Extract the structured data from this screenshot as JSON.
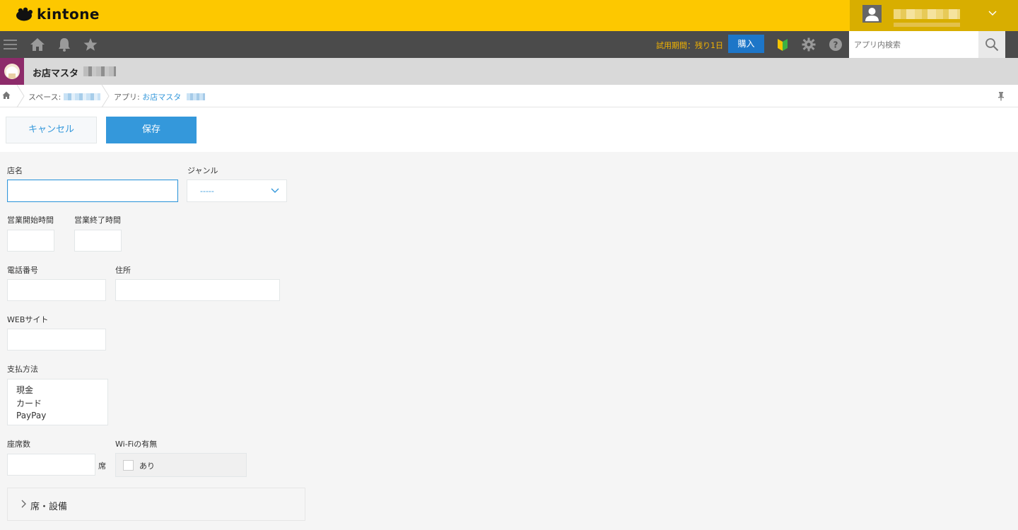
{
  "header": {
    "logo_text": "kintone",
    "user_menu_icon": "chevron-down-icon"
  },
  "nav": {
    "icons": [
      "menu-icon",
      "home-icon",
      "bell-icon",
      "star-icon"
    ],
    "trial_text": "試用期間：残り1日",
    "buy_label": "購入",
    "search_placeholder": "アプリ内検索"
  },
  "app": {
    "title": "お店マスタ"
  },
  "breadcrumb": {
    "space_prefix": "スペース: ",
    "app_prefix": "アプリ: ",
    "app_name": "お店マスタ"
  },
  "toolbar": {
    "cancel_label": "キャンセル",
    "save_label": "保存"
  },
  "form": {
    "shop_name_label": "店名",
    "genre_label": "ジャンル",
    "genre_value": "-----",
    "open_time_label": "営業開始時間",
    "close_time_label": "営業終了時間",
    "phone_label": "電話番号",
    "address_label": "住所",
    "website_label": "WEBサイト",
    "payment_label": "支払方法",
    "payment_options": [
      "現金",
      "カード",
      "PayPay"
    ],
    "seats_label": "座席数",
    "seats_unit": "席",
    "wifi_label": "Wi-Fiの有無",
    "wifi_option": "あり",
    "group_label": "席・設備"
  },
  "colors": {
    "brand_yellow": "#fdc800",
    "nav_dark": "#4b4b4b",
    "accent_blue": "#3498db"
  }
}
